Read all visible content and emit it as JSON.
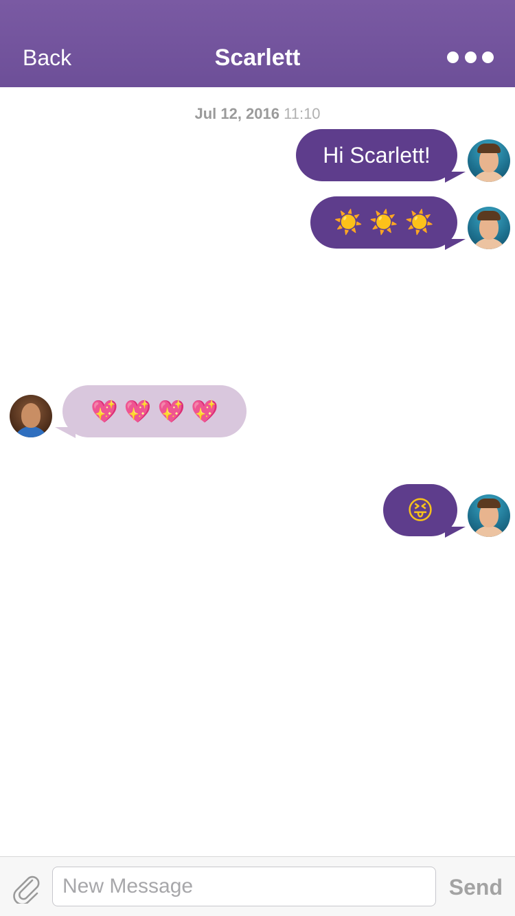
{
  "header": {
    "back_label": "Back",
    "title": "Scarlett",
    "more_icon": "ellipsis-icon",
    "background_color": "#7258a0"
  },
  "timestamp": {
    "date": "Jul 12, 2016",
    "time": "11:10"
  },
  "messages": [
    {
      "direction": "outgoing",
      "sender": "user",
      "text": "Hi Scarlett!"
    },
    {
      "direction": "outgoing",
      "sender": "user",
      "text": "☀️ ☀️ ☀️"
    },
    {
      "direction": "incoming",
      "sender": "Scarlett",
      "text": "💖 💖 💖 💖"
    },
    {
      "direction": "outgoing",
      "sender": "user",
      "text": "😝"
    }
  ],
  "colors": {
    "outgoing_bubble": "#5e3d8c",
    "incoming_bubble": "#d9c7dd"
  },
  "composer": {
    "attach_icon": "paperclip-icon",
    "placeholder": "New Message",
    "value": "",
    "send_label": "Send"
  }
}
